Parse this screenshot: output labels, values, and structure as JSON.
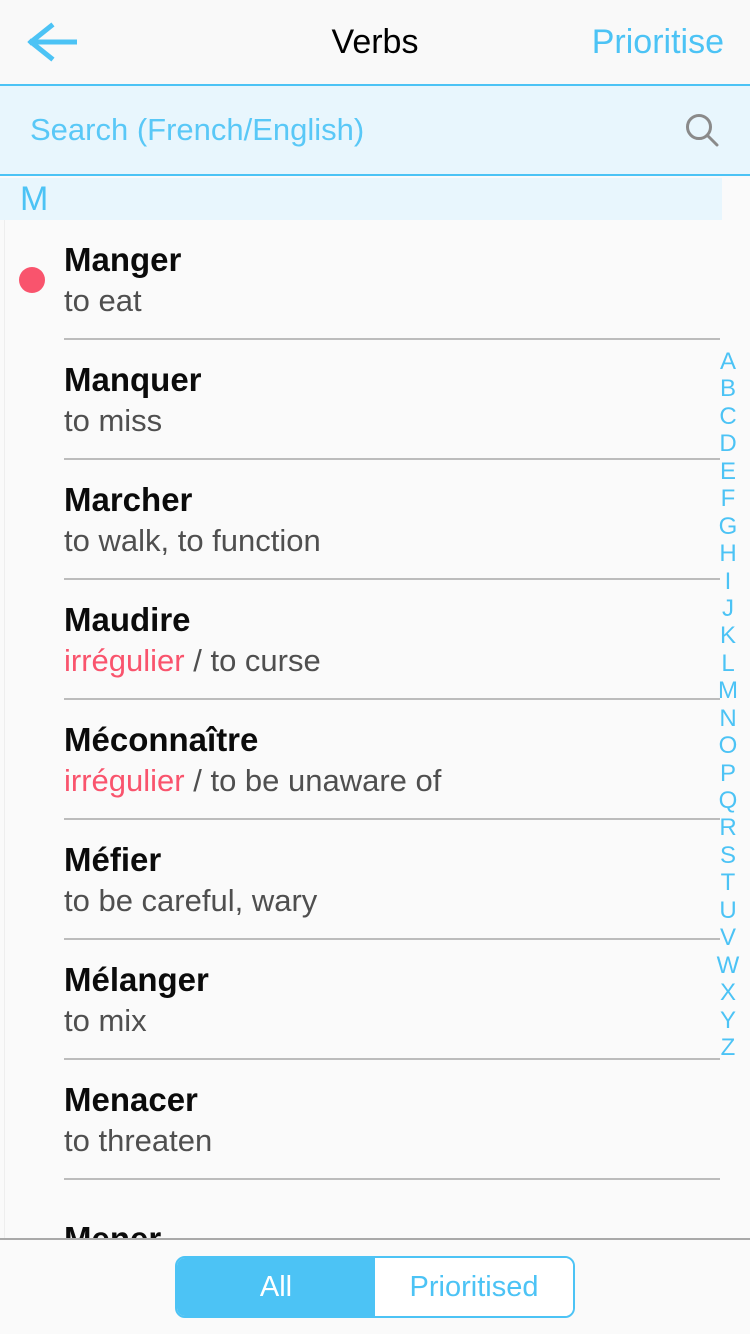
{
  "navbar": {
    "back_icon": "back-arrow-icon",
    "title": "Verbs",
    "action_label": "Prioritise"
  },
  "search": {
    "placeholder": "Search (French/English)",
    "value": "",
    "icon": "search-icon"
  },
  "section": {
    "letter": "M"
  },
  "list": {
    "items": [
      {
        "french": "Manger",
        "irregular": "",
        "separator": "",
        "english": "to eat",
        "prioritised": true
      },
      {
        "french": "Manquer",
        "irregular": "",
        "separator": "",
        "english": "to miss",
        "prioritised": false
      },
      {
        "french": "Marcher",
        "irregular": "",
        "separator": "",
        "english": "to walk, to function",
        "prioritised": false
      },
      {
        "french": "Maudire",
        "irregular": "irrégulier",
        "separator": " / ",
        "english": "to curse",
        "prioritised": false
      },
      {
        "french": "Méconnaître",
        "irregular": "irrégulier",
        "separator": " / ",
        "english": "to be unaware of",
        "prioritised": false
      },
      {
        "french": "Méfier",
        "irregular": "",
        "separator": "",
        "english": "to be careful, wary",
        "prioritised": false
      },
      {
        "french": "Mélanger",
        "irregular": "",
        "separator": "",
        "english": "to mix",
        "prioritised": false
      },
      {
        "french": "Menacer",
        "irregular": "",
        "separator": "",
        "english": "to threaten",
        "prioritised": false
      },
      {
        "french": "Mener",
        "irregular": "",
        "separator": "",
        "english": "",
        "prioritised": false
      }
    ]
  },
  "alpha_index": {
    "letters": [
      "A",
      "B",
      "C",
      "D",
      "E",
      "F",
      "G",
      "H",
      "I",
      "J",
      "K",
      "L",
      "M",
      "N",
      "O",
      "P",
      "Q",
      "R",
      "S",
      "T",
      "U",
      "V",
      "W",
      "X",
      "Y",
      "Z"
    ],
    "current": "M"
  },
  "bottom": {
    "segments": [
      {
        "label": "All",
        "selected": true
      },
      {
        "label": "Prioritised",
        "selected": false
      }
    ]
  },
  "colors": {
    "accent_blue": "#4cc3f5",
    "accent_pink": "#f9546d",
    "search_bg": "#e8f6fd",
    "page_bg": "#fafafa",
    "title_text": "#000000",
    "sub_text": "#4f4f4f",
    "separator": "#bcbcbc"
  }
}
